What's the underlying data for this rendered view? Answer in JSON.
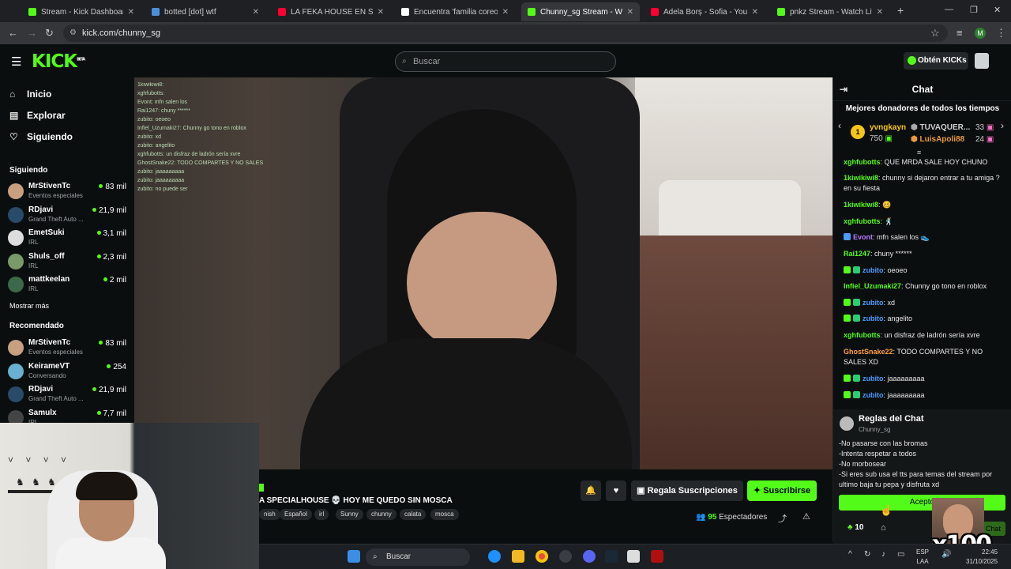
{
  "browser": {
    "tabs": [
      {
        "title": "Stream - Kick Dashboard",
        "color": "#53fc18"
      },
      {
        "title": "botted [dot] wtf",
        "color": "#4a90d9"
      },
      {
        "title": "LA FEKA HOUSE EN SU PRIME",
        "color": "#ff0033"
      },
      {
        "title": "Encuentra 'familia coreografia",
        "color": "#ffffff"
      },
      {
        "title": "Chunny_sg Stream - Watch",
        "color": "#53fc18"
      },
      {
        "title": "Adela Borș - Sofia - YouTube",
        "color": "#ff0033"
      },
      {
        "title": "pnkz Stream - Watch Live on Ki",
        "color": "#53fc18"
      }
    ],
    "url": "kick.com/chunny_sg",
    "profile_initial": "M"
  },
  "header": {
    "logo": "KICK",
    "logo_badge": "BETA",
    "search_placeholder": "Buscar",
    "get_kicks_label": "Obtén KICKs"
  },
  "sidebar": {
    "nav": [
      {
        "label": "Inicio",
        "icon": "home-icon"
      },
      {
        "label": "Explorar",
        "icon": "compass-icon"
      },
      {
        "label": "Siguiendo",
        "icon": "heart-icon"
      }
    ],
    "following_title": "Siguiendo",
    "following": [
      {
        "name": "MrStivenTc",
        "category": "Eventos especiales",
        "viewers": "83 mil",
        "color": "#c8a080"
      },
      {
        "name": "RDjavi",
        "category": "Grand Theft Auto ...",
        "viewers": "21,9 mil",
        "color": "#2a4a6a"
      },
      {
        "name": "EmetSuki",
        "category": "IRL",
        "viewers": "3,1 mil",
        "color": "#dddddd"
      },
      {
        "name": "Shuls_off",
        "category": "IRL",
        "viewers": "2,3 mil",
        "color": "#7a9a6a"
      },
      {
        "name": "mattkeelan",
        "category": "IRL",
        "viewers": "2 mil",
        "color": "#3a6a4a"
      }
    ],
    "show_more": "Mostrar más",
    "recommended_title": "Recomendado",
    "recommended": [
      {
        "name": "MrStivenTc",
        "category": "Eventos especiales",
        "viewers": "83 mil",
        "color": "#c8a080"
      },
      {
        "name": "KeirameVT",
        "category": "Conversando",
        "viewers": "254",
        "color": "#6ab0d0"
      },
      {
        "name": "RDjavi",
        "category": "Grand Theft Auto ...",
        "viewers": "21,9 mil",
        "color": "#2a4a6a"
      },
      {
        "name": "Samulx",
        "category": "IRL",
        "viewers": "7,7 mil",
        "color": "#444444"
      }
    ]
  },
  "video_overlay_chat": [
    "1kiwikiwi8:",
    "xghfubotts:",
    "Evont: mfn salen los",
    "Rai1247: chuny ******",
    "zubito: oeoeo",
    "Infiel_Uzumaki27: Chunny go tono en roblox",
    "zubito: xd",
    "zubito: angelito",
    "xghfubotts: un disfraz de ladrón sería xvre",
    "GhostSnake22: TODO COMPARTES Y NO SALES",
    "zubito: jaaaaaaaaa",
    "zubito: jaaaaaaaaa",
    "zubito: no puede ser"
  ],
  "stream": {
    "title": "A SPECIALHOUSE 💀 HOY ME QUEDO SIN MOSCA",
    "tags": [
      "nish",
      "Español",
      "irl",
      "Sunny",
      "chunny",
      "calata",
      "mosca"
    ],
    "gift_label": "Regala Suscripciones",
    "subscribe_label": "Suscribirse",
    "viewers_count": "95",
    "viewers_label": "Espectadores"
  },
  "chat": {
    "title": "Chat",
    "donors_title": "Mejores donadores de todos los tiempos",
    "donors": [
      {
        "name": "yvngkayn",
        "amount": "750",
        "color": "#f5c518"
      },
      {
        "name": "TUVAQUER...",
        "amount": "33",
        "color": "#cfcfcf"
      },
      {
        "name": "LuisApoli88",
        "amount": "24",
        "color": "#e89a3c"
      }
    ],
    "messages": [
      {
        "user": "xghfubotts",
        "text": "QUE MRDA SALE HOY CHUNO",
        "color": "#53fc18",
        "badges": 0
      },
      {
        "user": "1kiwikiwi8",
        "text": "chunny si dejaron entrar a tu amiga ? en su fiesta",
        "color": "#53fc18",
        "badges": 0
      },
      {
        "user": "1kiwikiwi8",
        "text": "🥴",
        "color": "#53fc18",
        "badges": 0
      },
      {
        "user": "xghfubotts",
        "text": "🕺",
        "color": "#53fc18",
        "badges": 0
      },
      {
        "user": "Evont",
        "text": "mfn salen los 👟",
        "color": "#b57bff",
        "badges": 1
      },
      {
        "user": "Rai1247",
        "text": "chuny ******",
        "color": "#53fc18",
        "badges": 0
      },
      {
        "user": "zubito",
        "text": "oeoeo",
        "color": "#4a9cff",
        "badges": 2
      },
      {
        "user": "Infiel_Uzumaki27",
        "text": "Chunny go tono en roblox",
        "color": "#53fc18",
        "badges": 0
      },
      {
        "user": "zubito",
        "text": "xd",
        "color": "#4a9cff",
        "badges": 2
      },
      {
        "user": "zubito",
        "text": "angelito",
        "color": "#4a9cff",
        "badges": 2
      },
      {
        "user": "xghfubotts",
        "text": "un disfraz de ladrón sería xvre",
        "color": "#53fc18",
        "badges": 0
      },
      {
        "user": "GhostSnake22",
        "text": "TODO COMPARTES Y NO SALES XD",
        "color": "#ff9f3c",
        "badges": 0
      },
      {
        "user": "zubito",
        "text": "jaaaaaaaaa",
        "color": "#4a9cff",
        "badges": 2
      },
      {
        "user": "zubito",
        "text": "jaaaaaaaaa",
        "color": "#4a9cff",
        "badges": 2
      }
    ],
    "rules_title": "Reglas del Chat",
    "rules_channel": "Chunny_sg",
    "rules_lines": [
      "-No pasarse con las bromas",
      "-Intenta respetar a todos",
      "-No morbosear",
      "-Si eres sub usa el tts para temas del stream por ultimo baja tu pepa y disfruta xd"
    ],
    "accept_label": "Acepto",
    "kicks_count": "10",
    "chat_button_label": "Chat"
  },
  "overlay_gif_text": "x100",
  "taskbar": {
    "search_placeholder": "Buscar",
    "lang_line1": "ESP",
    "lang_line2": "LAA",
    "time": "22:45",
    "date": "31/10/2025"
  }
}
